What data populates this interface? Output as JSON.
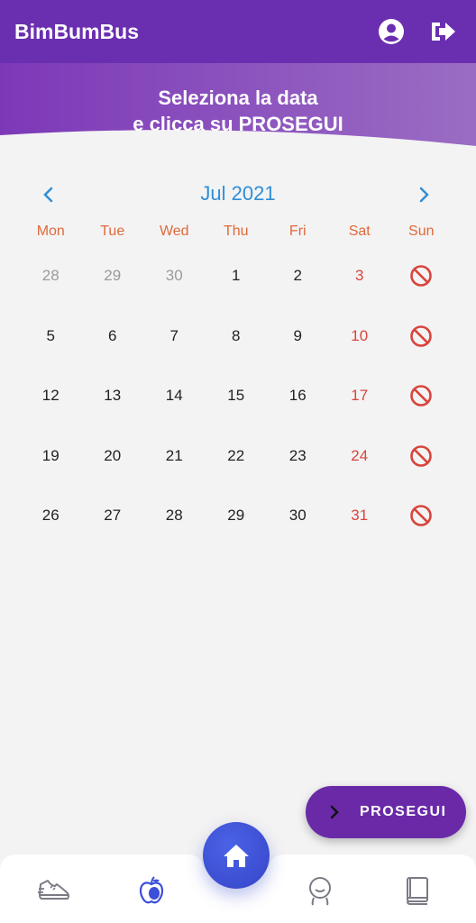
{
  "app": {
    "title": "BimBumBus"
  },
  "banner": {
    "line1": "Seleziona la data",
    "line2": "e clicca su PROSEGUI"
  },
  "calendar": {
    "month_label": "Jul 2021",
    "weekdays": [
      "Mon",
      "Tue",
      "Wed",
      "Thu",
      "Fri",
      "Sat",
      "Sun"
    ],
    "weeks": [
      [
        "28",
        "29",
        "30",
        "1",
        "2",
        "3",
        ""
      ],
      [
        "5",
        "6",
        "7",
        "8",
        "9",
        "10",
        ""
      ],
      [
        "12",
        "13",
        "14",
        "15",
        "16",
        "17",
        ""
      ],
      [
        "19",
        "20",
        "21",
        "22",
        "23",
        "24",
        ""
      ],
      [
        "26",
        "27",
        "28",
        "29",
        "30",
        "31",
        ""
      ]
    ],
    "other_month_days": [
      "28",
      "29",
      "30"
    ],
    "sunday_icon": "blocked-icon"
  },
  "actions": {
    "prosegui_label": "PROSEGUI"
  },
  "bottom_nav": {
    "items": [
      "shoe-icon",
      "apple-icon",
      "home-icon",
      "child-face-icon",
      "book-icon"
    ]
  },
  "colors": {
    "primary": "#6a2fb0",
    "accent_blue": "#2f8ed8",
    "weekday_orange": "#e0693a",
    "saturday_red": "#d9443c",
    "home_blue": "#3d4fd8"
  }
}
